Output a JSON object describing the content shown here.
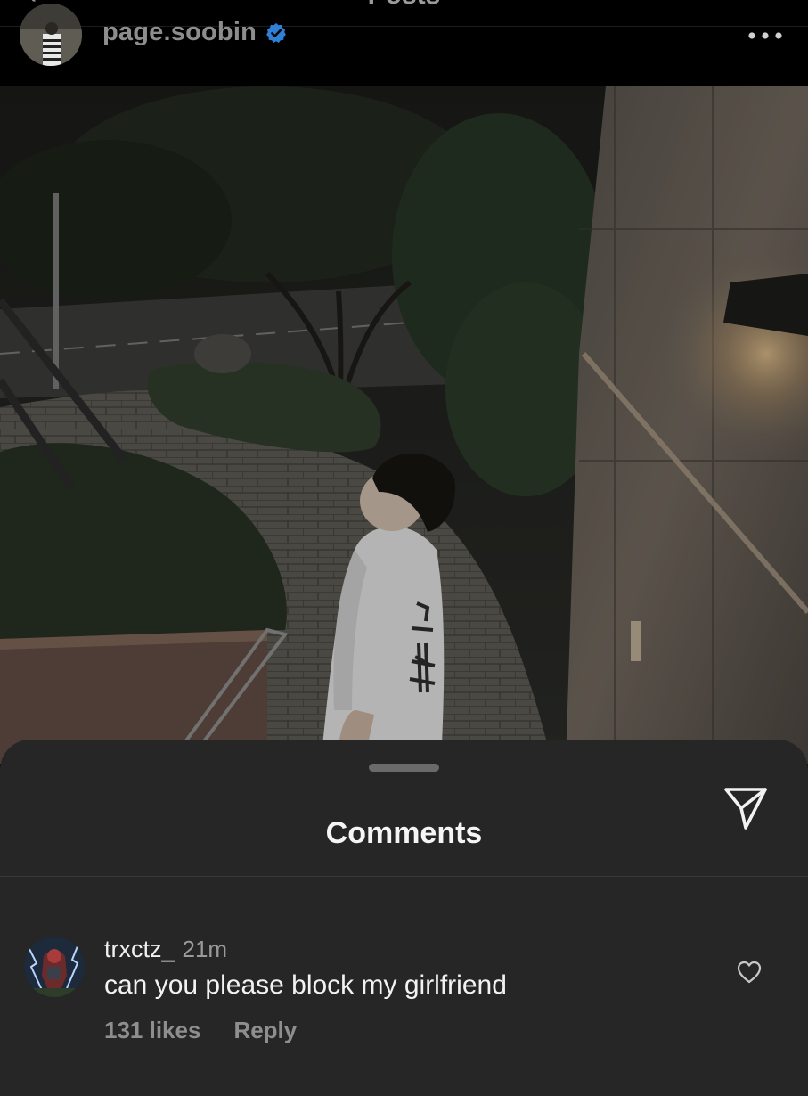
{
  "header": {
    "title": "Posts",
    "username": "page.soobin",
    "verified_icon": "verified-badge-icon",
    "more_icon": "more-options-icon",
    "back_icon": "chevron-left-icon"
  },
  "post": {
    "image": "photo of a person in a white t-shirt standing on a brick path at night, looking up, next to a wall with a lamp"
  },
  "comments_sheet": {
    "title": "Comments",
    "share_icon": "send-icon",
    "comments": [
      {
        "username": "trxctz_",
        "time": "21m",
        "text": "can you please block my girlfriend",
        "likes": "131 likes",
        "reply_label": "Reply",
        "like_icon": "heart-outline-icon"
      }
    ]
  },
  "colors": {
    "sheet_background": "#262626",
    "verified_blue": "#2f80d6",
    "muted_text": "#8e8e8e"
  }
}
